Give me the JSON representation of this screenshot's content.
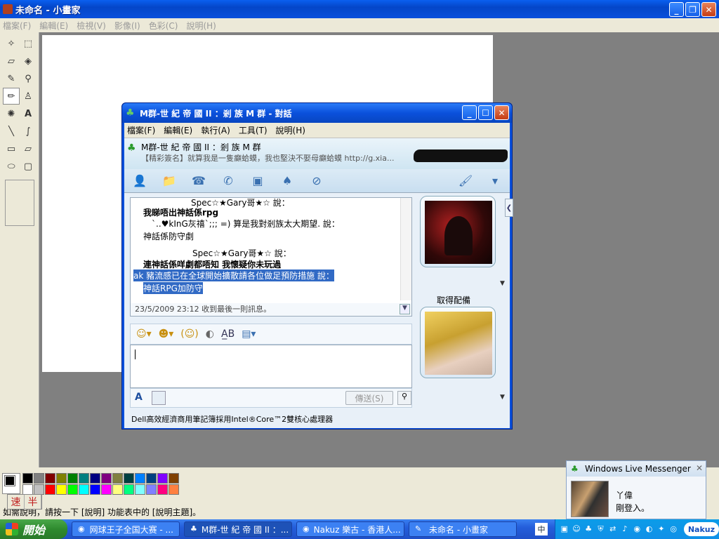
{
  "paint": {
    "title": "未命名 - 小畫家",
    "menu": [
      "檔案(F)",
      "編輯(E)",
      "檢視(V)",
      "影像(I)",
      "色彩(C)",
      "說明(H)"
    ],
    "status": "如需說明，請按一下 [說明] 功能表中的 [說明主題]。",
    "ime": [
      "速",
      "半"
    ],
    "palette": [
      "#000000",
      "#808080",
      "#800000",
      "#808000",
      "#008000",
      "#008080",
      "#000080",
      "#800080",
      "#808040",
      "#004040",
      "#0080ff",
      "#004080",
      "#8000ff",
      "#804000",
      "#ffffff",
      "#c0c0c0",
      "#ff0000",
      "#ffff00",
      "#00ff00",
      "#00ffff",
      "#0000ff",
      "#ff00ff",
      "#ffff80",
      "#00ff80",
      "#80ffff",
      "#8080ff",
      "#ff0080",
      "#ff8040"
    ]
  },
  "chat": {
    "title": "M群-世 紀 帝 國 II ：剎 族 M 群 - 對話",
    "menu": [
      "檔案(F)",
      "編輯(E)",
      "執行(A)",
      "工具(T)",
      "說明(H)"
    ],
    "contact_name": "M群-世 紀 帝 國 II ：剎 族 M 群",
    "contact_psm": "【精彩簽名】就算我是一隻癲蛤蟆，我也堅決不娶母癲蛤蟆 http://g.xia...",
    "history": [
      {
        "text": "Spec☆★Gary哥★☆ 說：",
        "style": "normal"
      },
      {
        "text": "我睇唔出神話係rpg",
        "style": "bold"
      },
      {
        "text": "`..♥kInG灰禧`;;; =) 算是我對剎族太大期望. 說：",
        "style": "normal"
      },
      {
        "text": "神話係防守劇",
        "style": "normal"
      },
      {
        "text": "Spec☆★Gary哥★☆ 說：",
        "style": "normal"
      },
      {
        "text": "連神話係咩劇都唔知 我懷疑你未玩過",
        "style": "bold"
      },
      {
        "text": "ak 豬流感已在全球開始擴散請各位做足預防措施 說：",
        "style": "sel"
      },
      {
        "text": "神話RPG加防守",
        "style": "sel"
      }
    ],
    "last_message": "23/5/2009 23:12 收到最後一則訊息。",
    "send_label": "傳送(S)",
    "avatar_caption": "取得配備",
    "ad": "Dell高效經濟商用筆記簿採用Intel®Core™2雙核心處理器"
  },
  "toast": {
    "app": "Windows Live Messenger",
    "name": "丫偉",
    "status": "剛登入。"
  },
  "taskbar": {
    "start": "開始",
    "tasks": [
      "网球王子全国大赛 - ...",
      "M群-世 紀 帝 國 II ：...",
      "Nakuz 樂古 - 香港人...",
      "未命名 - 小畫家"
    ],
    "tray_logo": "Nakuz"
  }
}
